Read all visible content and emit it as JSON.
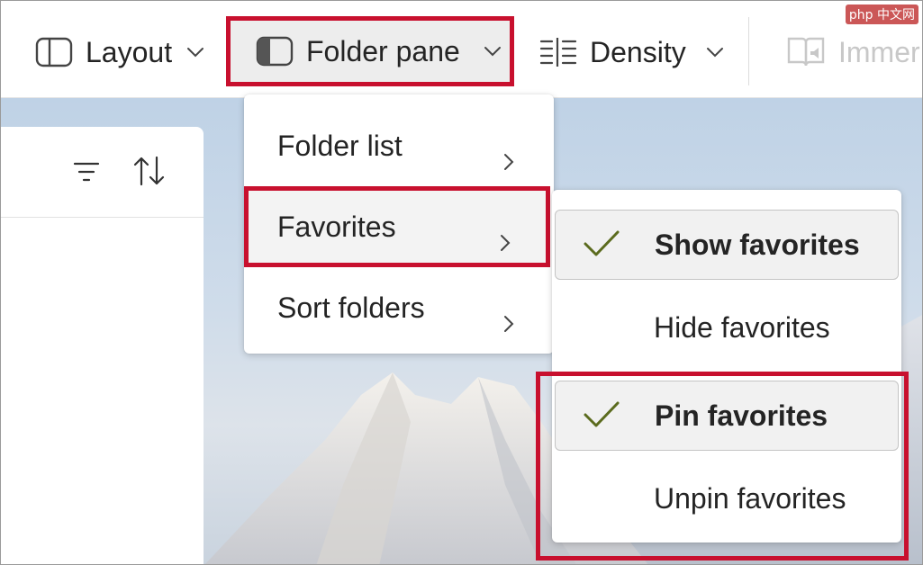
{
  "toolbar": {
    "layout_label": "Layout",
    "folder_pane_label": "Folder pane",
    "density_label": "Density",
    "immersive_label": "Immer"
  },
  "folder_pane_menu": {
    "items": [
      {
        "label": "Folder list"
      },
      {
        "label": "Favorites"
      },
      {
        "label": "Sort folders"
      }
    ]
  },
  "favorites_submenu": {
    "items": [
      {
        "label": "Show favorites",
        "checked": true
      },
      {
        "label": "Hide favorites",
        "checked": false
      },
      {
        "label": "Pin favorites",
        "checked": true
      },
      {
        "label": "Unpin favorites",
        "checked": false
      }
    ]
  },
  "watermark": "php 中文网",
  "colors": {
    "highlight": "#c8102e",
    "check": "#5b6b1e",
    "text": "#242424",
    "disabled_text": "#c8c8c8"
  }
}
